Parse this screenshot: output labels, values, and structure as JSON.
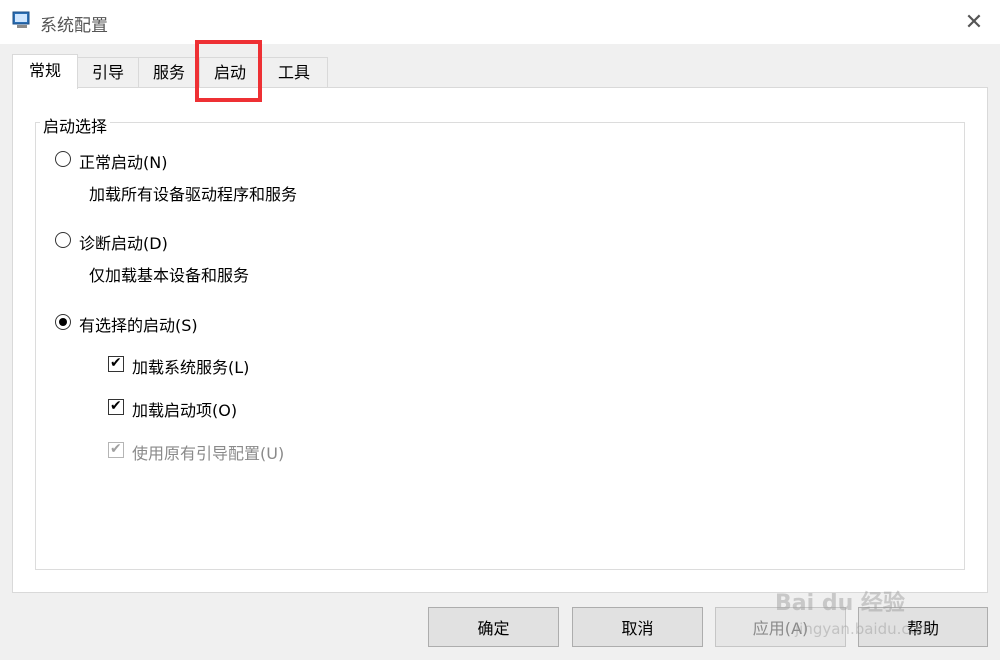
{
  "window": {
    "title": "系统配置",
    "close_glyph": "✕",
    "icon": "system-config-icon"
  },
  "tabs": [
    {
      "label": "常规",
      "active": true
    },
    {
      "label": "引导",
      "active": false
    },
    {
      "label": "服务",
      "active": false
    },
    {
      "label": "启动",
      "active": false,
      "highlighted": true
    },
    {
      "label": "工具",
      "active": false
    }
  ],
  "startup_selection": {
    "group_label": "启动选择",
    "options": [
      {
        "label": "正常启动(N)",
        "description": "加载所有设备驱动程序和服务",
        "selected": false
      },
      {
        "label": "诊断启动(D)",
        "description": "仅加载基本设备和服务",
        "selected": false
      },
      {
        "label": "有选择的启动(S)",
        "selected": true
      }
    ],
    "checkboxes": [
      {
        "label": "加载系统服务(L)",
        "checked": true,
        "enabled": true
      },
      {
        "label": "加载启动项(O)",
        "checked": true,
        "enabled": true
      },
      {
        "label": "使用原有引导配置(U)",
        "checked": true,
        "enabled": false
      }
    ]
  },
  "buttons": {
    "ok": "确定",
    "cancel": "取消",
    "apply": "应用(A)",
    "help": "帮助"
  },
  "colors": {
    "highlight_box": "#ee3034",
    "window_bg": "#f0f0f0",
    "panel_bg": "#ffffff"
  },
  "watermark": {
    "brand": "Bai du 经验",
    "url": "jingyan.baidu.com"
  }
}
